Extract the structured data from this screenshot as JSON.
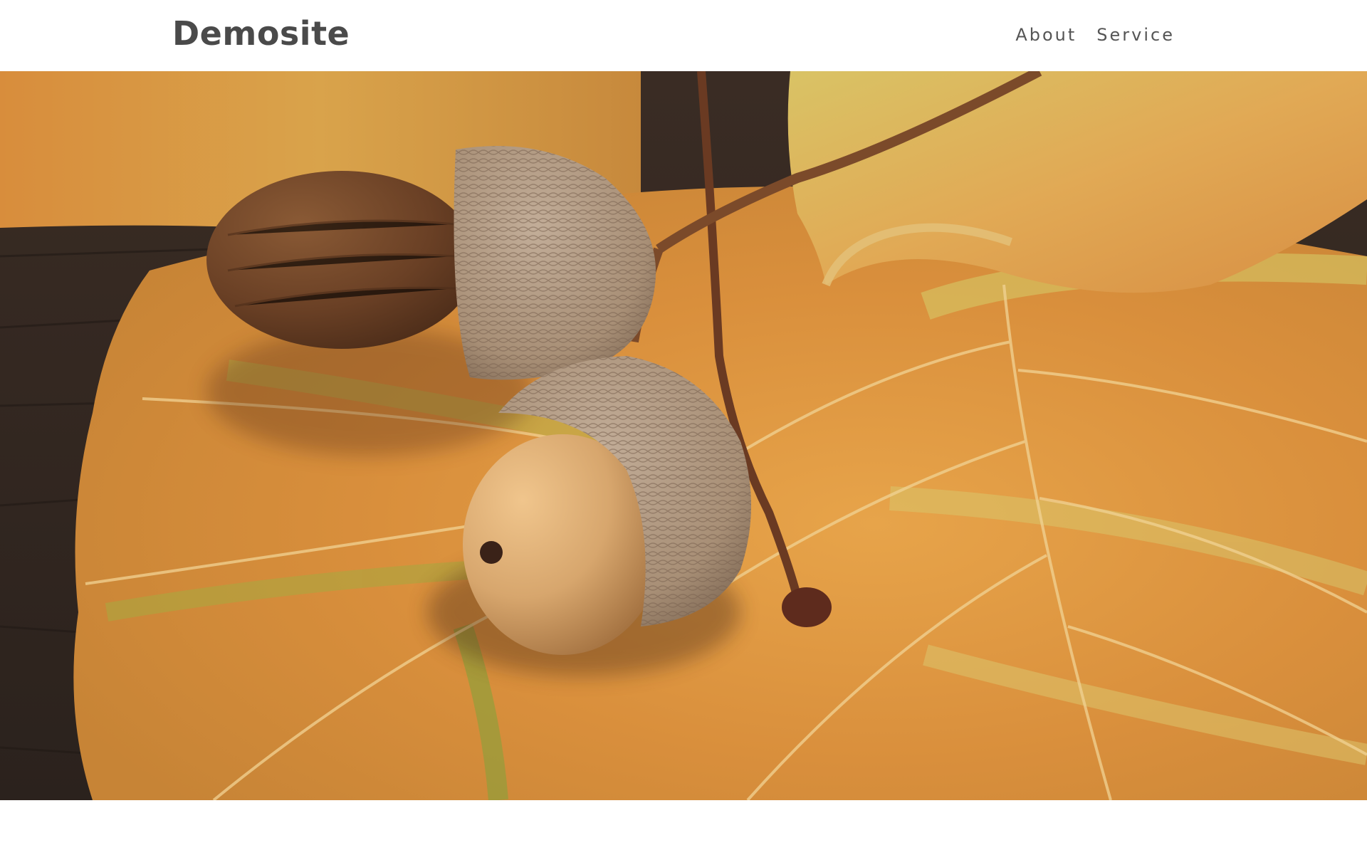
{
  "site": {
    "logo": "Demosite"
  },
  "nav": {
    "items": [
      {
        "label": "About"
      },
      {
        "label": "Service"
      }
    ]
  },
  "hero": {
    "image": "acorns-on-autumn-leaves",
    "colors": {
      "leaf_orange": "#d8923f",
      "leaf_yellow": "#d9c46a",
      "leaf_green": "#9aa849",
      "wood": "#3d2f27",
      "acorn_brown": "#6a4025",
      "acorn_light": "#d7a66d",
      "cap": "#a88f76"
    }
  }
}
